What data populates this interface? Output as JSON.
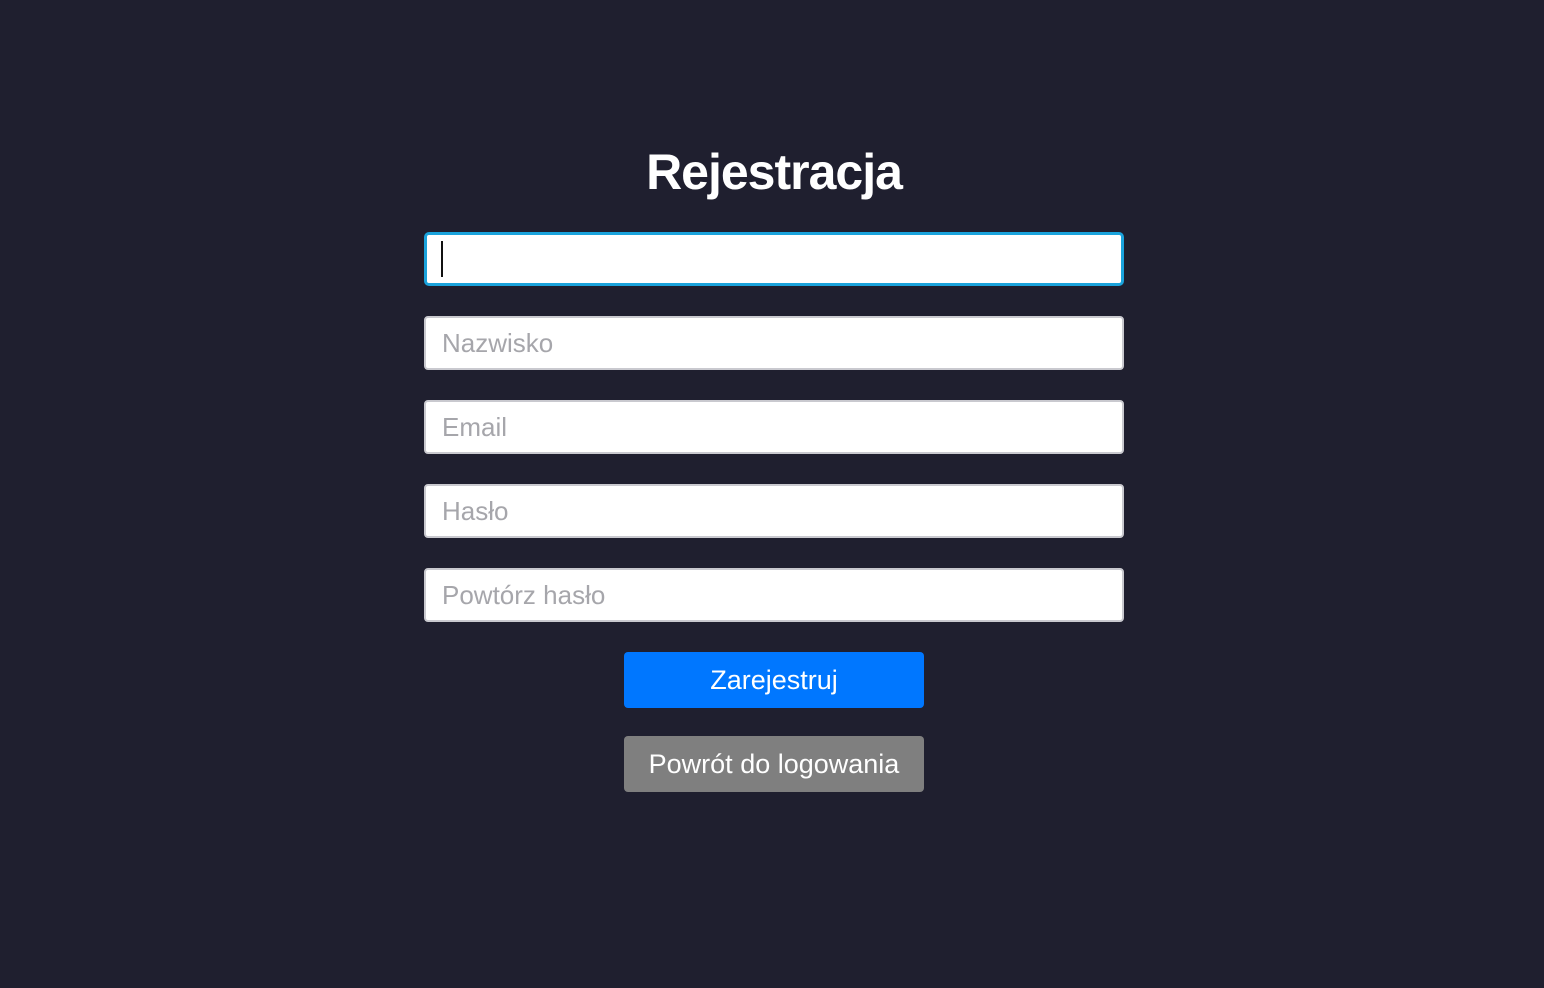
{
  "form": {
    "title": "Rejestracja",
    "fields": [
      {
        "name": "first-name",
        "value": "",
        "placeholder": ""
      },
      {
        "name": "last-name",
        "value": "",
        "placeholder": "Nazwisko"
      },
      {
        "name": "email",
        "value": "",
        "placeholder": "Email"
      },
      {
        "name": "password",
        "value": "",
        "placeholder": "Hasło"
      },
      {
        "name": "repeat-password",
        "value": "",
        "placeholder": "Powtórz hasło"
      }
    ],
    "register_label": "Zarejestruj",
    "back_label": "Powrót do logowania"
  },
  "colors": {
    "background": "#1f1f2f",
    "primary": "#0077ff",
    "secondary": "#7f7f7f",
    "focus": "#1aa3dc"
  }
}
